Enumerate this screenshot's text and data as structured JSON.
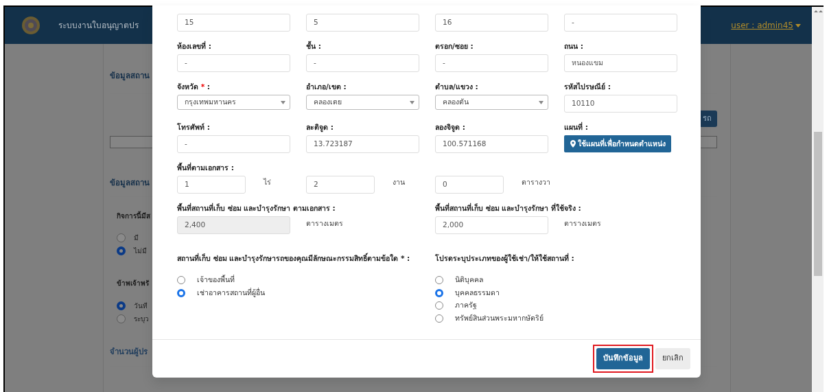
{
  "navbar": {
    "title": "ระบบงานใบอนุญาตปร",
    "user": "user : admin45"
  },
  "background": {
    "heading_1": "ข้อมูลสถาน",
    "side_button": "รถ",
    "heading_2": "ข้อมูลสถาน",
    "question_1": "กิจการนี้มีส",
    "options_1": [
      {
        "label": "มี",
        "selected": false
      },
      {
        "label": "ไม่มี",
        "selected": true
      }
    ],
    "question_2": "ข้าพเจ้าพรั",
    "options_2": [
      {
        "label": "วันที",
        "selected": true
      },
      {
        "label": "ระบุว",
        "selected": false
      }
    ],
    "heading_3": "จำนวนผู้ปร"
  },
  "modal": {
    "field_rows": [
      [
        {
          "kind": "input",
          "value": "15"
        },
        {
          "kind": "input",
          "value": "5"
        },
        {
          "kind": "input",
          "value": "16"
        },
        {
          "kind": "input",
          "value": "-"
        }
      ],
      [
        {
          "kind": "input",
          "label": "ห้องเลขที่ :",
          "value": "-"
        },
        {
          "kind": "input",
          "label": "ชั้น :",
          "value": "-"
        },
        {
          "kind": "input",
          "label": "ตรอก/ซอย :",
          "value": "-"
        },
        {
          "kind": "input",
          "label": "ถนน :",
          "value": "หนองแขม"
        }
      ],
      [
        {
          "kind": "select",
          "label": "จังหวัด",
          "required_mark": "*",
          "label_end": ":",
          "value": "กรุงเทพมหานคร"
        },
        {
          "kind": "select",
          "label": "อำเภอ/เขต :",
          "value": "คลองเตย"
        },
        {
          "kind": "select",
          "label": "ตำบล/แขวง :",
          "value": "คลองตัน"
        },
        {
          "kind": "input",
          "label": "รหัสไปรษณีย์ :",
          "value": "10110"
        }
      ],
      [
        {
          "kind": "input",
          "label": "โทรศัพท์ :",
          "value": "-"
        },
        {
          "kind": "input",
          "label": "ละติจูด :",
          "value": "13.723187"
        },
        {
          "kind": "input",
          "label": "ลองจิจูด :",
          "value": "100.571168"
        },
        {
          "kind": "map_button",
          "label": "แผนที่ :",
          "value": "ใช้แผนที่เพื่อกำหนดตำแหน่ง"
        }
      ]
    ],
    "area": {
      "label": "พื้นที่ตามเอกสาร :",
      "parts": [
        {
          "value": "1",
          "unit": "ไร่"
        },
        {
          "value": "2",
          "unit": "งาน"
        },
        {
          "value": "0",
          "unit": "ตารางวา"
        }
      ]
    },
    "sizes": [
      {
        "label": "พื้นที่สถานที่เก็บ ซ่อม และบำรุงรักษา ตามเอกสาร :",
        "value": "2,400",
        "disabled": true,
        "unit": "ตารางเมตร"
      },
      {
        "label": "พื้นที่สถานที่เก็บ ซ่อม และบำรุงรักษา ที่ใช้จริง :",
        "value": "2,000",
        "disabled": false,
        "unit": "ตารางเมตร"
      }
    ],
    "radio_groups": [
      {
        "label": "สถานที่เก็บ ซ่อม และบำรุงรักษารถของคุณมีลักษณะกรรมสิทธิ์ตามข้อใด * :",
        "options": [
          {
            "label": "เจ้าของพื้นที่",
            "selected": false
          },
          {
            "label": "เช่าอาคารสถานที่ผู้อื่น",
            "selected": true
          }
        ]
      },
      {
        "label": "โปรดระบุประเภทของผู้ใช้เช่า/ให้ใช้สถานที่ :",
        "options": [
          {
            "label": "นิติบุคคล",
            "selected": false
          },
          {
            "label": "บุคคลธรรมดา",
            "selected": true
          },
          {
            "label": "ภาครัฐ",
            "selected": false
          },
          {
            "label": "ทรัพย์สินส่วนพระมหากษัตริย์",
            "selected": false
          }
        ]
      }
    ],
    "buttons": [
      {
        "label": "บันทึกข้อมูล",
        "kind": "primary",
        "highlighted": true
      },
      {
        "label": "ยกเลิก",
        "kind": "secondary",
        "highlighted": false
      }
    ]
  }
}
